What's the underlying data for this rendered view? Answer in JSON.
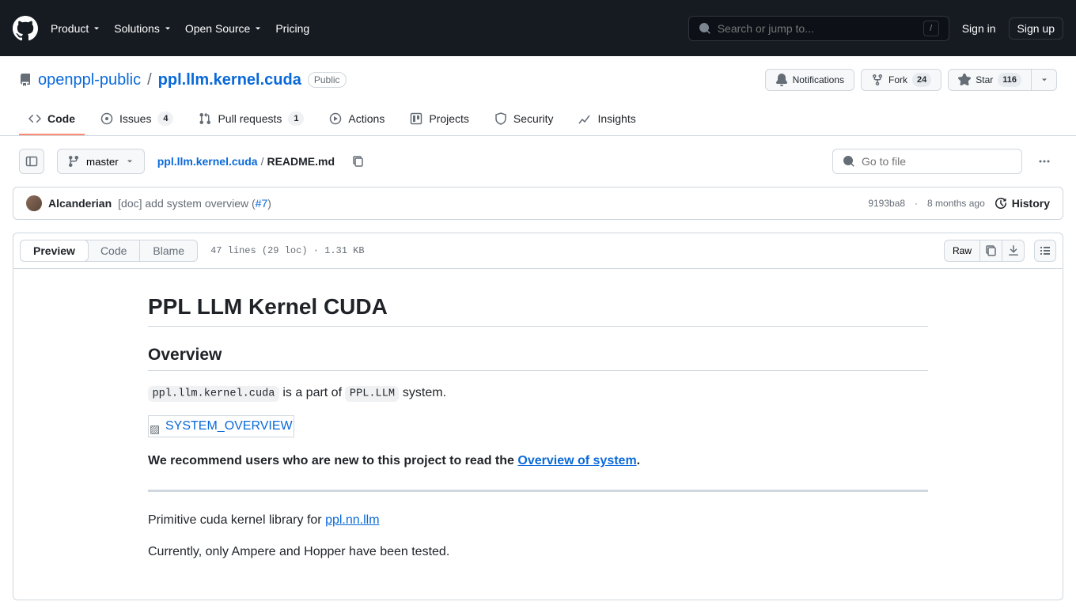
{
  "header": {
    "nav": {
      "product": "Product",
      "solutions": "Solutions",
      "opensource": "Open Source",
      "pricing": "Pricing"
    },
    "search_placeholder": "Search or jump to...",
    "slash": "/",
    "signin": "Sign in",
    "signup": "Sign up"
  },
  "repo": {
    "owner": "openppl-public",
    "name": "ppl.llm.kernel.cuda",
    "visibility": "Public",
    "actions": {
      "notifications": "Notifications",
      "fork": "Fork",
      "fork_count": "24",
      "star": "Star",
      "star_count": "116"
    },
    "nav": {
      "code": "Code",
      "issues": "Issues",
      "issues_count": "4",
      "pulls": "Pull requests",
      "pulls_count": "1",
      "actions": "Actions",
      "projects": "Projects",
      "security": "Security",
      "insights": "Insights"
    }
  },
  "file": {
    "branch": "master",
    "breadcrumb_root": "ppl.llm.kernel.cuda",
    "breadcrumb_file": "README.md",
    "goto_placeholder": "Go to file"
  },
  "commit": {
    "author": "Alcanderian",
    "msg_prefix": "[doc] add system overview (",
    "msg_link": "#7",
    "msg_suffix": ")",
    "sha": "9193ba8",
    "dot": "·",
    "date": "8 months ago",
    "history": "History"
  },
  "fileview": {
    "preview": "Preview",
    "code": "Code",
    "blame": "Blame",
    "meta": "47 lines (29 loc) · 1.31 KB",
    "raw": "Raw"
  },
  "readme": {
    "h1": "PPL LLM Kernel CUDA",
    "h2_overview": "Overview",
    "p1_code1": "ppl.llm.kernel.cuda",
    "p1_mid": " is a part of ",
    "p1_code2": "PPL.LLM",
    "p1_end": " system.",
    "img_alt": "SYSTEM_OVERVIEW",
    "p2_strong": "We recommend users who are new to this project to read the ",
    "p2_link": "Overview of system",
    "p2_end": ".",
    "p3_pre": "Primitive cuda kernel library for ",
    "p3_link": "ppl.nn.llm",
    "p4": "Currently, only Ampere and Hopper have been tested."
  }
}
